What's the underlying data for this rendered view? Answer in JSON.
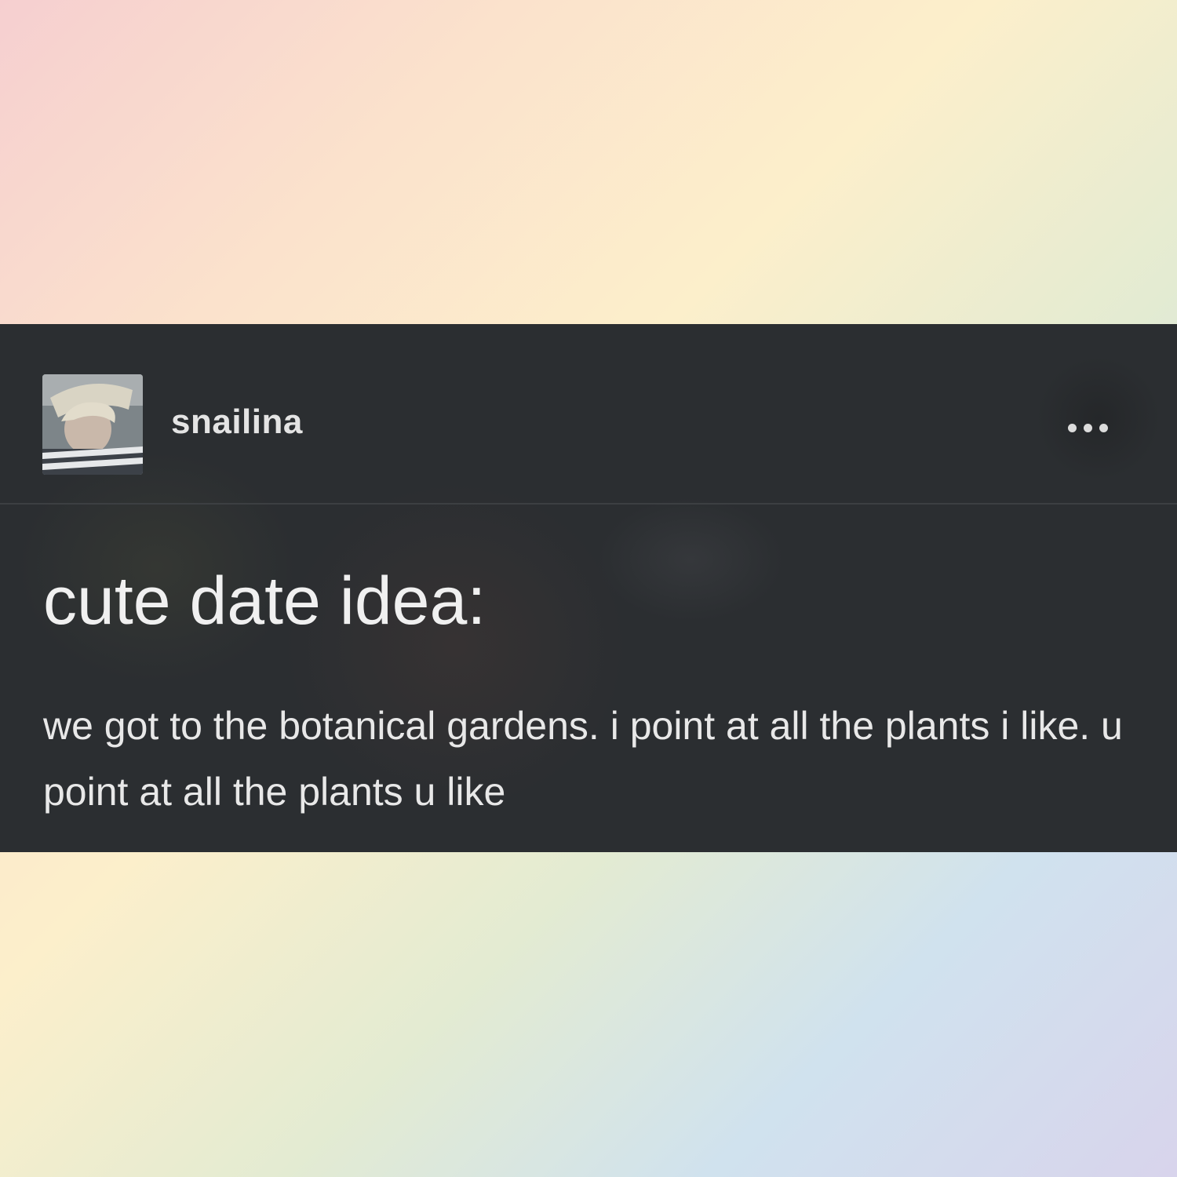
{
  "post": {
    "username": "snailina",
    "more_icon": "ellipsis-horizontal-icon",
    "title": "cute date idea:",
    "body": "we got to the botanical gardens. i point at all the plants i like. u point at all the plants u like"
  },
  "colors": {
    "card_background": "#2b2e31",
    "text": "#f0f0f0"
  }
}
